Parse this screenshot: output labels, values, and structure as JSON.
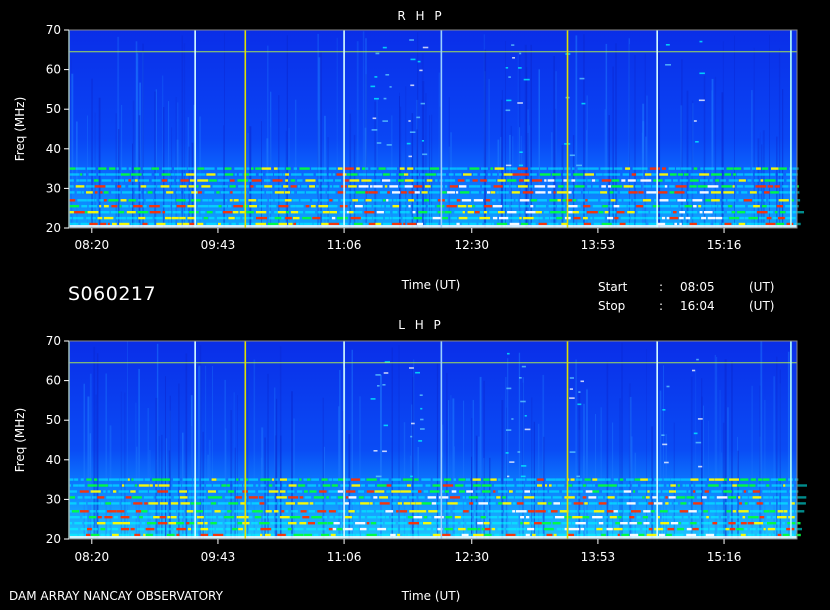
{
  "station_id": "S060217",
  "footer_label": "DAM ARRAY   NANCAY OBSERVATORY",
  "start_label": "Start",
  "start_time": "08:05",
  "stop_label": "Stop",
  "stop_time": "16:04",
  "colon": ":",
  "ut_unit": "(UT)",
  "chart_data": [
    {
      "type": "heatmap",
      "title": "R H P",
      "xlabel": "Time (UT)",
      "ylabel": "Freq (MHz)",
      "xlim": [
        "08:05",
        "16:04"
      ],
      "ylim": [
        20,
        70
      ],
      "x_ticks": [
        "08:20",
        "09:43",
        "11:06",
        "12:30",
        "13:53",
        "15:16"
      ],
      "y_ticks": [
        20,
        30,
        40,
        50,
        60,
        70
      ],
      "colormap": [
        "#0018ff",
        "#0090ff",
        "#00ffff",
        "#00ff40",
        "#ffff00",
        "#ff2000",
        "#ffffff"
      ],
      "background": "#0a3cf0",
      "vertical_lines": [
        {
          "time": "08:05",
          "color": "#b0ffff"
        },
        {
          "time": "09:28",
          "color": "#d8ffff"
        },
        {
          "time": "10:01",
          "color": "#e0e000"
        },
        {
          "time": "11:06",
          "color": "#d8ffff"
        },
        {
          "time": "12:10",
          "color": "#9ad0ff"
        },
        {
          "time": "13:33",
          "color": "#e0e000"
        },
        {
          "time": "14:32",
          "color": "#d8ffff"
        },
        {
          "time": "16:00",
          "color": "#b0ffff"
        }
      ],
      "horizontal_lines": [
        {
          "freq": 64.5,
          "color": "#c0ff40"
        }
      ]
    },
    {
      "type": "heatmap",
      "title": "L H P",
      "xlabel": "Time (UT)",
      "ylabel": "Freq (MHz)",
      "xlim": [
        "08:05",
        "16:04"
      ],
      "ylim": [
        20,
        70
      ],
      "x_ticks": [
        "08:20",
        "09:43",
        "11:06",
        "12:30",
        "13:53",
        "15:16"
      ],
      "y_ticks": [
        20,
        30,
        40,
        50,
        60,
        70
      ],
      "colormap": [
        "#0018ff",
        "#0090ff",
        "#00ffff",
        "#00ff40",
        "#ffff00",
        "#ff2000",
        "#ffffff"
      ],
      "background": "#0a3cf0",
      "vertical_lines": [
        {
          "time": "08:05",
          "color": "#b0ffff"
        },
        {
          "time": "09:28",
          "color": "#d8ffff"
        },
        {
          "time": "10:01",
          "color": "#e0e000"
        },
        {
          "time": "11:06",
          "color": "#d8ffff"
        },
        {
          "time": "12:10",
          "color": "#9ad0ff"
        },
        {
          "time": "13:33",
          "color": "#e0e000"
        },
        {
          "time": "14:32",
          "color": "#d8ffff"
        },
        {
          "time": "16:00",
          "color": "#b0ffff"
        }
      ],
      "horizontal_lines": [
        {
          "freq": 64.5,
          "color": "#c0ff40"
        }
      ]
    }
  ]
}
